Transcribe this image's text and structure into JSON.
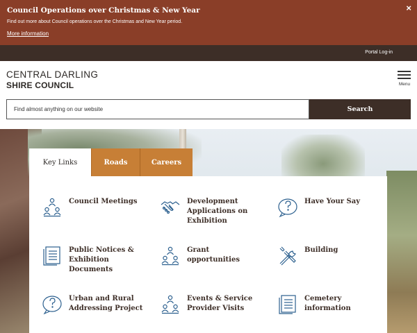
{
  "alert": {
    "title": "Council Operations over Christmas & New Year",
    "text": "Find out more about Council operations over the Christmas and New Year period.",
    "link": "More information",
    "close": "×"
  },
  "utility": {
    "portal_login": "Portal Log-in"
  },
  "logo": {
    "line1": "CENTRAL DARLING",
    "line2": "SHIRE COUNCIL"
  },
  "menu": {
    "label": "Menu"
  },
  "search": {
    "placeholder": "Find almost anything on our website",
    "button": "Search"
  },
  "tabs": [
    {
      "label": "Key Links",
      "active": true
    },
    {
      "label": "Roads",
      "active": false
    },
    {
      "label": "Careers",
      "active": false
    }
  ],
  "key_links": [
    {
      "label": "Council Meetings",
      "icon": "people-group-icon"
    },
    {
      "label": "Development Applications on Exhibition",
      "icon": "handshake-icon"
    },
    {
      "label": "Have Your Say",
      "icon": "question-bubble-icon"
    },
    {
      "label": "Public Notices & Exhibition Documents",
      "icon": "documents-icon"
    },
    {
      "label": "Grant opportunities",
      "icon": "people-group-icon"
    },
    {
      "label": "Building",
      "icon": "tools-icon"
    },
    {
      "label": "Urban and Rural Addressing Project",
      "icon": "question-bubble-icon"
    },
    {
      "label": "Events & Service Provider Visits",
      "icon": "people-group-icon"
    },
    {
      "label": "Cemetery information",
      "icon": "documents-icon"
    }
  ],
  "colors": {
    "alert_bg": "#8a3e28",
    "dark_brown": "#3d2e27",
    "tab_orange": "#c77f36",
    "icon_blue": "#2b5f8e"
  }
}
